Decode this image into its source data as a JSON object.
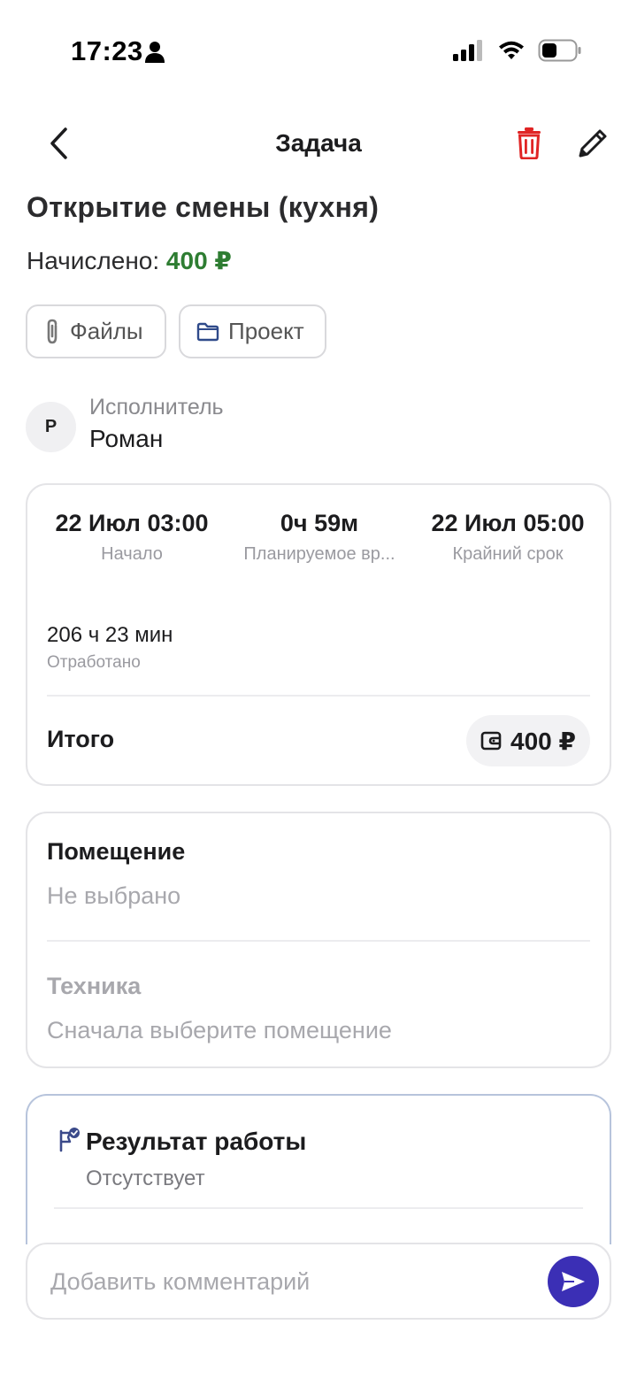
{
  "status_bar": {
    "time": "17:23"
  },
  "header": {
    "title": "Задача"
  },
  "task": {
    "title": "Открытие смены (кухня)",
    "accrued_label": "Начислено:",
    "accrued_amount": "400 ₽"
  },
  "chips": {
    "files_label": "Файлы",
    "project_label": "Проект"
  },
  "assignee": {
    "initial": "Р",
    "label": "Исполнитель",
    "name": "Роман"
  },
  "time_card": {
    "start_value": "22 Июл 03:00",
    "start_label": "Начало",
    "planned_value": "0ч 59м",
    "planned_label": "Планируемое вр...",
    "deadline_value": "22 Июл 05:00",
    "deadline_label": "Крайний срок",
    "worked_value": "206 ч 23 мин",
    "worked_label": "Отработано",
    "total_label": "Итого",
    "total_amount": "400 ₽"
  },
  "room_card": {
    "room_title": "Помещение",
    "room_value": "Не выбрано",
    "equipment_title": "Техника",
    "equipment_value": "Сначала выберите помещение"
  },
  "result_card": {
    "title": "Результат работы",
    "value": "Отсутствует"
  },
  "comment": {
    "placeholder": "Добавить комментарий"
  },
  "colors": {
    "accent_send": "#3b2fb5",
    "accrued_green": "#2e7d32",
    "delete_red": "#e02424",
    "project_icon": "#2f4a8a"
  },
  "icons": {
    "back": "chevron-left-icon",
    "delete": "trash-icon",
    "edit": "pencil-icon",
    "files": "paperclip-icon",
    "project": "folder-icon",
    "wallet": "wallet-icon",
    "result": "flag-check-icon",
    "send": "send-icon"
  }
}
